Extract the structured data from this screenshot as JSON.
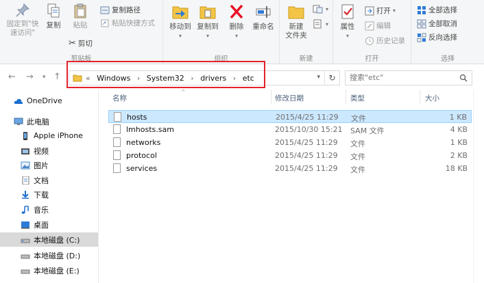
{
  "ribbon": {
    "clipboard": {
      "pin_quick_access": "固定到\"快\n速访问\"",
      "copy": "复制",
      "paste": "粘贴",
      "cut": "剪切",
      "copy_path": "复制路径",
      "paste_shortcut": "粘贴快捷方式",
      "group_label": "剪贴板"
    },
    "organize": {
      "move_to": "移动到",
      "copy_to": "复制到",
      "delete": "删除",
      "rename": "重命名",
      "group_label": "组织"
    },
    "new": {
      "new_folder": "新建\n文件夹",
      "group_label": "新建"
    },
    "open": {
      "properties": "属性",
      "open": "打开",
      "edit": "编辑",
      "history": "历史记录",
      "group_label": "打开"
    },
    "select": {
      "select_all": "全部选择",
      "select_none": "全部取消",
      "invert_selection": "反向选择",
      "group_label": "选择"
    }
  },
  "address": {
    "prefix": "«",
    "crumbs": [
      "Windows",
      "›",
      "System32",
      "›",
      "drivers",
      "›",
      "etc"
    ],
    "search_placeholder": "搜索\"etc\""
  },
  "nav": {
    "items": [
      {
        "label": "OneDrive",
        "icon": "cloud-icon"
      },
      {
        "label": "此电脑",
        "icon": "computer-icon"
      },
      {
        "label": "Apple iPhone",
        "icon": "phone-icon"
      },
      {
        "label": "视频",
        "icon": "video-icon"
      },
      {
        "label": "图片",
        "icon": "picture-icon"
      },
      {
        "label": "文档",
        "icon": "document-icon"
      },
      {
        "label": "下载",
        "icon": "download-icon"
      },
      {
        "label": "音乐",
        "icon": "music-icon"
      },
      {
        "label": "桌面",
        "icon": "desktop-icon"
      },
      {
        "label": "本地磁盘 (C:)",
        "icon": "drive-icon"
      },
      {
        "label": "本地磁盘 (D:)",
        "icon": "drive-icon"
      },
      {
        "label": "本地磁盘 (E:)",
        "icon": "drive-icon"
      }
    ]
  },
  "files": {
    "headers": {
      "name": "名称",
      "date": "修改日期",
      "type": "类型",
      "size": "大小"
    },
    "rows": [
      {
        "name": "hosts",
        "date": "2015/4/25 11:29",
        "type": "文件",
        "size": "1 KB"
      },
      {
        "name": "lmhosts.sam",
        "date": "2015/10/30 15:21",
        "type": "SAM 文件",
        "size": "4 KB"
      },
      {
        "name": "networks",
        "date": "2015/4/25 11:29",
        "type": "文件",
        "size": "1 KB"
      },
      {
        "name": "protocol",
        "date": "2015/4/25 11:29",
        "type": "文件",
        "size": "2 KB"
      },
      {
        "name": "services",
        "date": "2015/4/25 11:29",
        "type": "文件",
        "size": "18 KB"
      }
    ]
  },
  "colors": {
    "highlight_box": "#e4222b",
    "selected_row": "#cce8ff",
    "folder_yellow": "#f3c446",
    "delete_red": "#e81123"
  }
}
